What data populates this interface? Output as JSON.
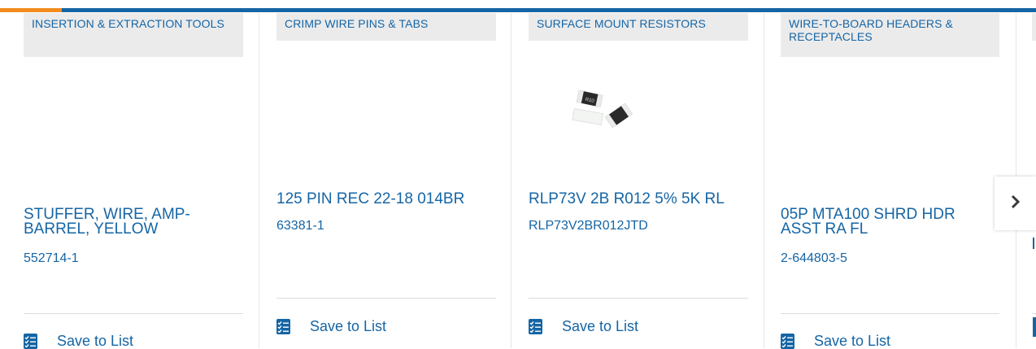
{
  "colors": {
    "brand": "#1565a5",
    "accent": "#f28c1e",
    "category_bg": "#ebebeb"
  },
  "cards": [
    {
      "category": "INSERTION & EXTRACTION TOOLS",
      "name": "STUFFER, WIRE, AMP-BARREL, YELLOW",
      "part_number": "552714-1",
      "save_label": "Save to List"
    },
    {
      "category": "CRIMP WIRE PINS & TABS",
      "name": "125 PIN REC 22-18 014BR",
      "part_number": "63381-1",
      "save_label": "Save to List"
    },
    {
      "category": "SURFACE MOUNT RESISTORS",
      "name": "RLP73V 2B R012 5% 5K RL",
      "part_number": "RLP73V2BR012JTD",
      "save_label": "Save to List",
      "image": "resistor-image"
    },
    {
      "category": "WIRE-TO-BOARD HEADERS & RECEPTACLES",
      "name": "05P MTA100 SHRD HDR ASST RA FL",
      "part_number": "2-644803-5",
      "save_label": "Save to List"
    }
  ],
  "carousel": {
    "next_icon": "chevron-right-icon"
  }
}
